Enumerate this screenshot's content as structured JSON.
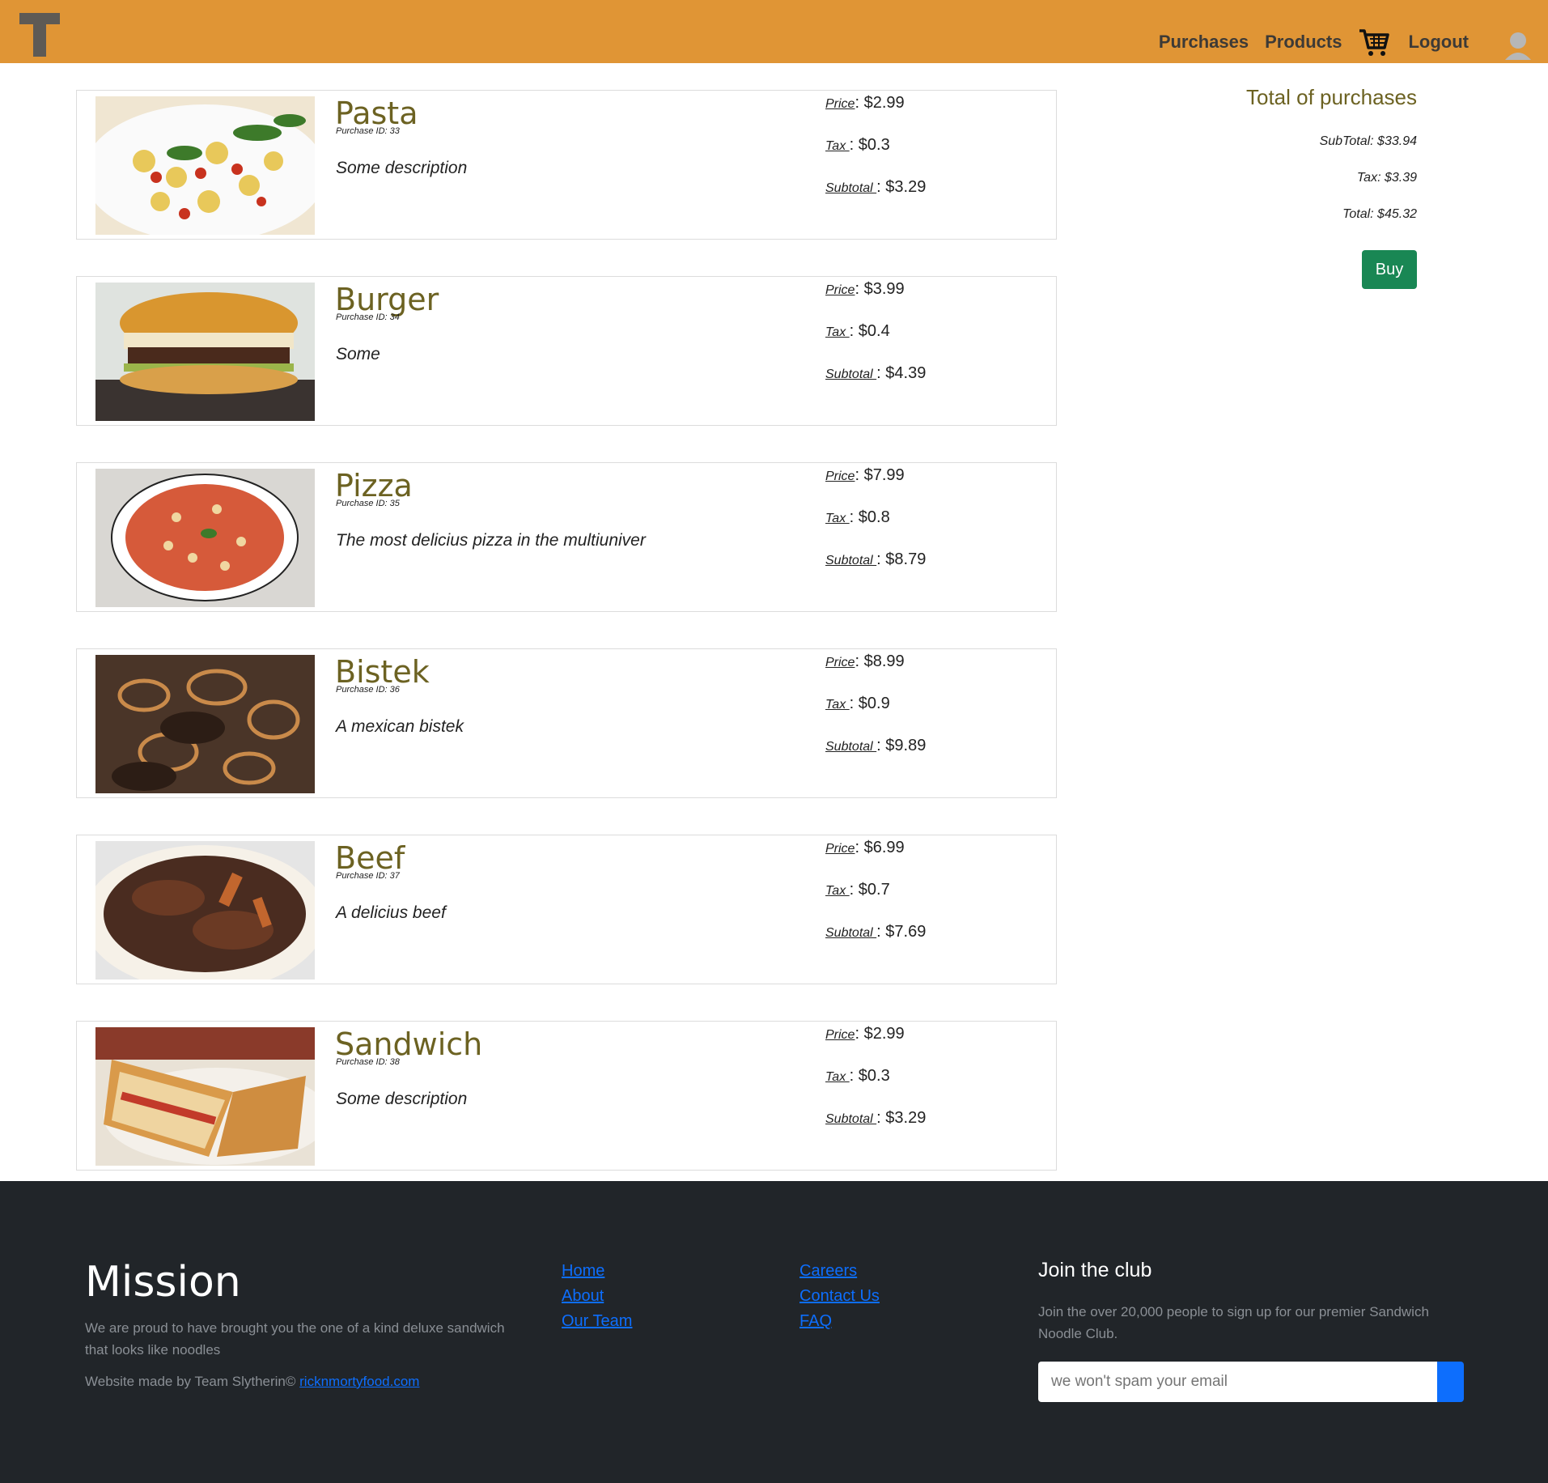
{
  "nav": {
    "links": [
      "Purchases",
      "Products",
      "Logout"
    ]
  },
  "purchases": [
    {
      "name": "Pasta",
      "purchase_id": "Purchase ID: 33",
      "description": "Some description",
      "price": "$2.99",
      "tax": "$0.3",
      "subtotal": "$3.29",
      "image_icon": "pasta-image"
    },
    {
      "name": "Burger",
      "purchase_id": "Purchase ID: 34",
      "description": "Some",
      "price": "$3.99",
      "tax": "$0.4",
      "subtotal": "$4.39",
      "image_icon": "burger-image"
    },
    {
      "name": "Pizza",
      "purchase_id": "Purchase ID: 35",
      "description": "The most delicius pizza in the multiuniver",
      "price": "$7.99",
      "tax": "$0.8",
      "subtotal": "$8.79",
      "image_icon": "pizza-image"
    },
    {
      "name": "Bistek",
      "purchase_id": "Purchase ID: 36",
      "description": "A mexican bistek",
      "price": "$8.99",
      "tax": "$0.9",
      "subtotal": "$9.89",
      "image_icon": "bistek-image"
    },
    {
      "name": "Beef",
      "purchase_id": "Purchase ID: 37",
      "description": "A delicius beef",
      "price": "$6.99",
      "tax": "$0.7",
      "subtotal": "$7.69",
      "image_icon": "beef-image"
    },
    {
      "name": "Sandwich",
      "purchase_id": "Purchase ID: 38",
      "description": "Some description",
      "price": "$2.99",
      "tax": "$0.3",
      "subtotal": "$3.29",
      "image_icon": "sandwich-image"
    }
  ],
  "labels": {
    "price": "Price",
    "tax": "Tax ",
    "subtotal": "Subtotal "
  },
  "totals": {
    "title": "Total of purchases",
    "subtotal": "SubTotal: $33.94",
    "tax": "Tax: $3.39",
    "total": "Total: $45.32",
    "buy_label": "Buy"
  },
  "footer": {
    "mission_title": "Mission",
    "mission_text": "We are proud to have brought you the one of a kind deluxe sandwich that looks like noodles",
    "made_by": "Website made by Team Slytherin©",
    "site_link": "ricknmortyfood.com",
    "col1": [
      "Home",
      "About",
      "Our Team"
    ],
    "col2": [
      "Careers",
      "Contact Us",
      "FAQ"
    ],
    "join_title": "Join the club",
    "join_text": "Join the over 20,000 people to sign up for our premier Sandwich Noodle Club.",
    "email_placeholder": "we won't spam your email"
  },
  "colors": {
    "navbar": "#e09535",
    "title": "#6c6222",
    "buy": "#198754",
    "footer": "#212529",
    "link": "#0d6efd"
  }
}
